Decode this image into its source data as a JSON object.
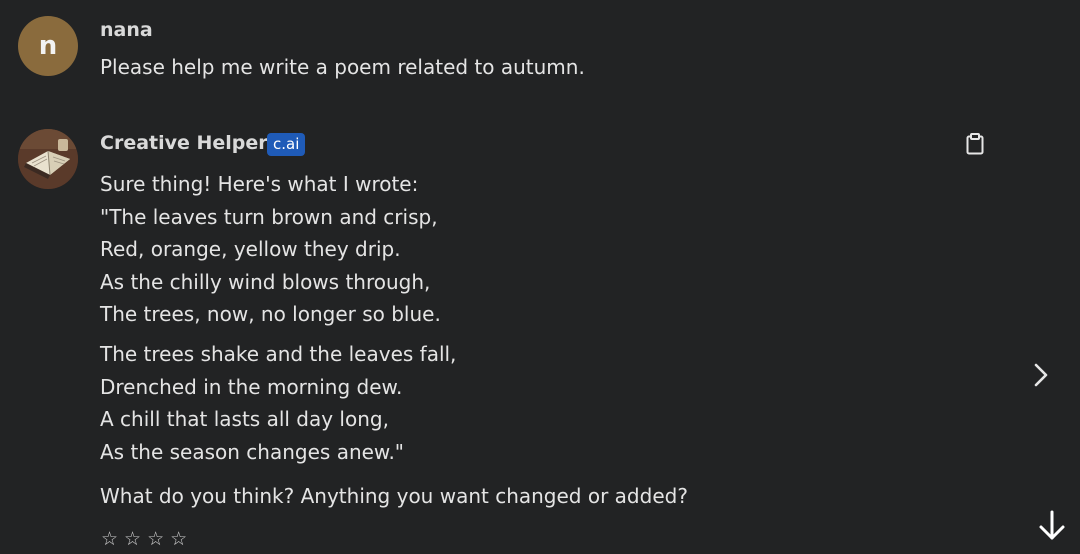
{
  "user": {
    "name": "nana",
    "initial": "n",
    "message": "Please help me write a poem related to autumn."
  },
  "bot": {
    "name": "Creative Helper",
    "badge": "c.ai",
    "intro": "Sure thing! Here's what I wrote:",
    "stanza1": [
      "\"The leaves turn brown and crisp,",
      "Red, orange, yellow they drip.",
      "As the chilly wind blows through,",
      "The trees, now, no longer so blue."
    ],
    "stanza2": [
      "The trees shake and the leaves fall,",
      "Drenched in the morning dew.",
      "A chill that lasts all day long,",
      "As the season changes anew.\""
    ],
    "closing": "What do you think? Anything you want changed or added?"
  },
  "rating": {
    "stars": [
      "☆",
      "☆",
      "☆",
      "☆"
    ]
  },
  "icons": {
    "copy": "clipboard-icon",
    "next": "chevron-right-icon",
    "scroll": "arrow-down-icon"
  },
  "colors": {
    "background": "#222324",
    "user_avatar": "#8a6b3d",
    "badge": "#1f5bb8"
  }
}
